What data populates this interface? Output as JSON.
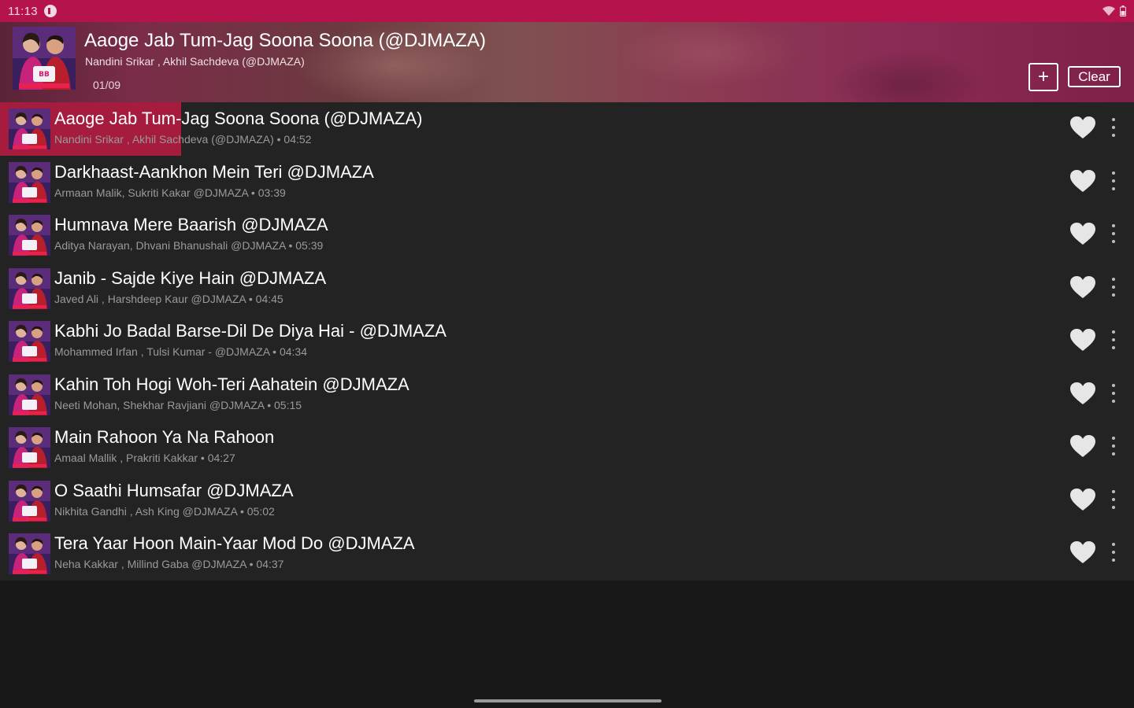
{
  "status_bar": {
    "time": "11:13",
    "color": "#b5134b"
  },
  "now_playing": {
    "title": "Aaoge Jab Tum-Jag Soona Soona (@DJMAZA)",
    "artist": "Nandini Srikar , Akhil Sachdeva (@DJMAZA)",
    "counter": "01/09",
    "add_label": "+",
    "clear_label": "Clear"
  },
  "playlist": {
    "progress_fraction": 0.16,
    "accent_color": "#a51c3e",
    "tracks": [
      {
        "title": "Aaoge Jab Tum-Jag Soona Soona (@DJMAZA)",
        "subtitle": "Nandini Srikar , Akhil Sachdeva (@DJMAZA) • 04:52"
      },
      {
        "title": "Darkhaast-Aankhon Mein Teri @DJMAZA",
        "subtitle": "Armaan Malik, Sukriti Kakar @DJMAZA • 03:39"
      },
      {
        "title": "Humnava Mere Baarish @DJMAZA",
        "subtitle": "Aditya Narayan, Dhvani Bhanushali @DJMAZA • 05:39"
      },
      {
        "title": "Janib - Sajde Kiye Hain @DJMAZA",
        "subtitle": "Javed Ali , Harshdeep Kaur @DJMAZA • 04:45"
      },
      {
        "title": "Kabhi Jo Badal Barse-Dil De Diya Hai - @DJMAZA",
        "subtitle": "Mohammed Irfan , Tulsi Kumar - @DJMAZA • 04:34"
      },
      {
        "title": "Kahin Toh Hogi Woh-Teri Aahatein @DJMAZA",
        "subtitle": "Neeti Mohan, Shekhar Ravjiani @DJMAZA • 05:15"
      },
      {
        "title": "Main Rahoon Ya Na Rahoon",
        "subtitle": "Amaal Mallik , Prakriti Kakkar • 04:27"
      },
      {
        "title": "O Saathi Humsafar @DJMAZA",
        "subtitle": "Nikhita Gandhi , Ash King @DJMAZA • 05:02"
      },
      {
        "title": "Tera Yaar Hoon Main-Yaar Mod Do @DJMAZA",
        "subtitle": "Neha Kakkar , Millind Gaba @DJMAZA • 04:37"
      }
    ]
  }
}
